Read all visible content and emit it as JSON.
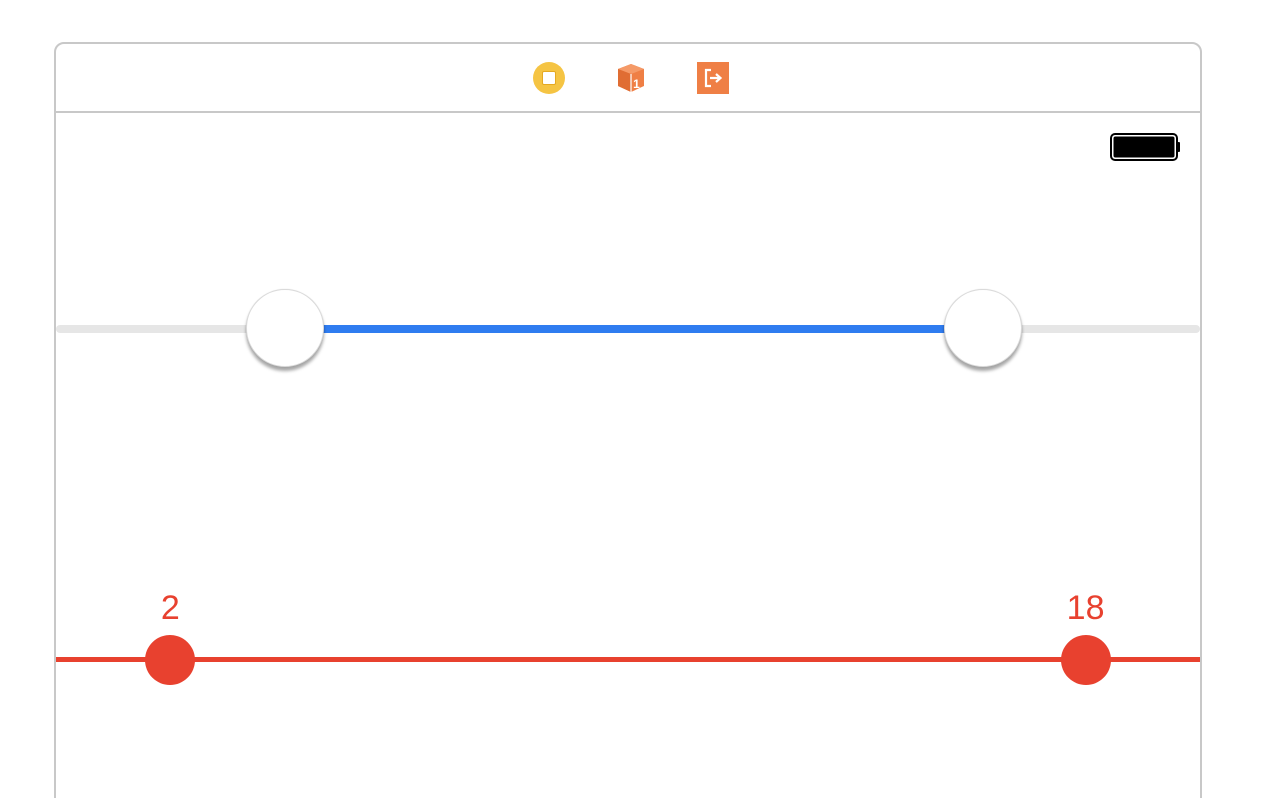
{
  "scene": {
    "dock_icons": [
      "view-controller-icon",
      "first-responder-icon",
      "exit-icon"
    ],
    "status_bar": {
      "battery_icon": "battery-full-icon"
    }
  },
  "range_slider": {
    "lower_value": 0.2,
    "upper_value": 0.81,
    "track_color": "#e6e6e6",
    "fill_color": "#2f7cf0",
    "thumb_color": "#ffffff"
  },
  "value_slider": {
    "lower_value": 0.1,
    "upper_value": 0.9,
    "lower_label": "2",
    "upper_label": "18",
    "color": "#e8412f"
  },
  "colors": {
    "accent_blue": "#2f7cf0",
    "accent_red": "#e8412f",
    "vc_yellow": "#f5c443",
    "object_orange": "#ef7f45"
  }
}
